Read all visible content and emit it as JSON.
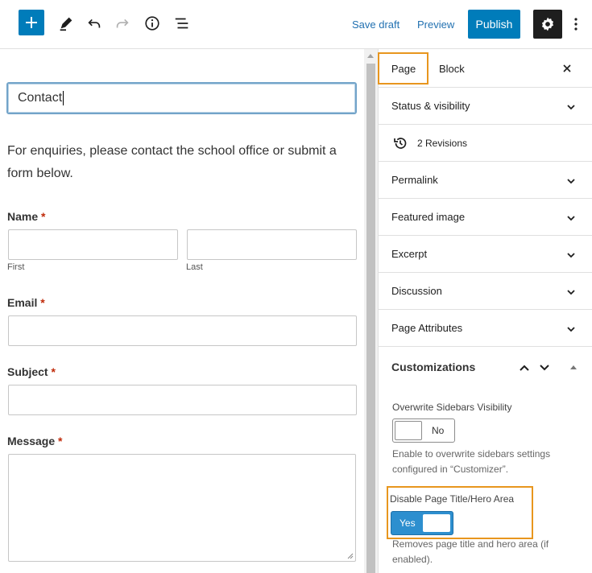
{
  "toolbar": {
    "save_draft": "Save draft",
    "preview": "Preview",
    "publish": "Publish"
  },
  "editor": {
    "title": "Contact",
    "intro": "For enquiries, please contact the school office or submit a form below.",
    "form": {
      "name_label": "Name",
      "first_label": "First",
      "last_label": "Last",
      "email_label": "Email",
      "subject_label": "Subject",
      "message_label": "Message",
      "required_mark": "*"
    }
  },
  "sidebar": {
    "tabs": {
      "page": "Page",
      "block": "Block"
    },
    "close": "×",
    "panels": {
      "status": "Status & visibility",
      "revisions": "2 Revisions",
      "permalink": "Permalink",
      "featured_image": "Featured image",
      "excerpt": "Excerpt",
      "discussion": "Discussion",
      "page_attributes": "Page Attributes"
    },
    "customizations": {
      "title": "Customizations",
      "sidebars_label": "Overwrite Sidebars Visibility",
      "sidebars_toggle": "No",
      "sidebars_desc": "Enable to overwrite sidebars settings configured in “Customizer”.",
      "hero_label": "Disable Page Title/Hero Area",
      "hero_toggle": "Yes",
      "hero_desc": "Removes page title and hero area (if enabled)."
    }
  },
  "colors": {
    "accent": "#007cba",
    "highlight": "#e8961e",
    "required": "#c02b0a"
  }
}
